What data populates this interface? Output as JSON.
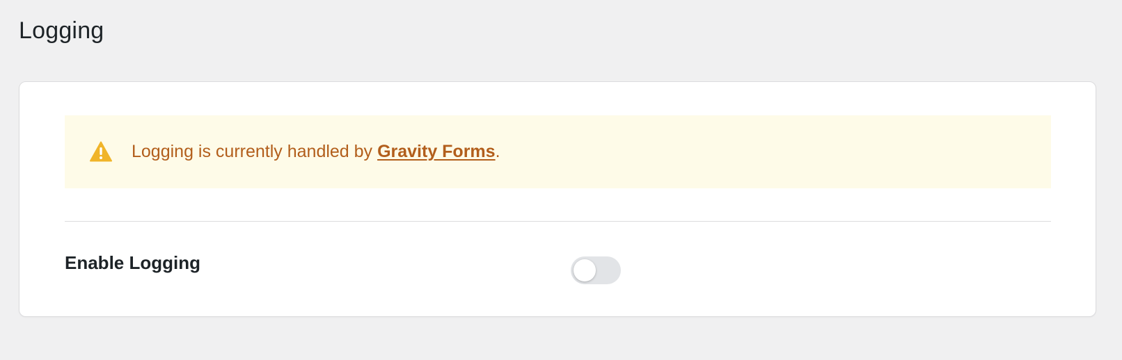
{
  "page": {
    "title": "Logging"
  },
  "notice": {
    "icon": "warning-icon",
    "text_before": "Logging is currently handled by",
    "link_text": "Gravity Forms",
    "text_after": ".",
    "colors": {
      "background": "#fefbe8",
      "text": "#b25e1b",
      "icon": "#f0b429"
    }
  },
  "settings": {
    "enable_logging": {
      "label": "Enable Logging",
      "enabled": false
    }
  }
}
